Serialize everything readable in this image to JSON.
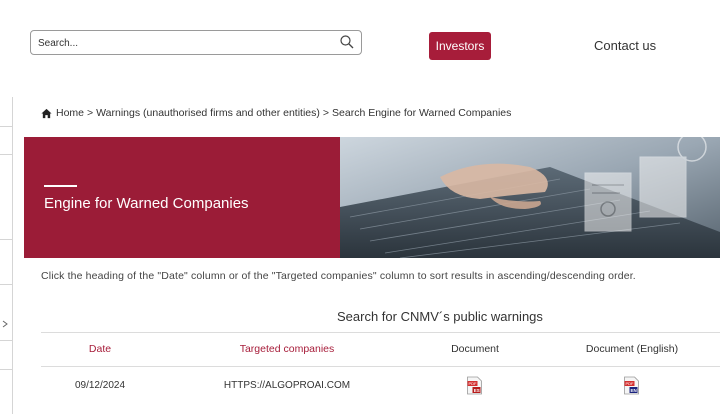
{
  "header": {
    "search_placeholder": "Search...",
    "investors_label": "Investors",
    "contact_label": "Contact us"
  },
  "breadcrumb": {
    "items": [
      "Home",
      "Warnings (unauthorised firms and other entities)",
      "Search Engine for Warned Companies"
    ],
    "separator": ">"
  },
  "banner": {
    "title": "Engine for Warned Companies"
  },
  "instructions": "Click the heading of the \"Date\" column or of the \"Targeted companies\" column to sort results in ascending/descending order.",
  "table": {
    "title": "Search for CNMV´s public warnings",
    "headers": [
      "Date",
      "Targeted companies",
      "Document",
      "Document (English)"
    ],
    "rows": [
      {
        "date": "09/12/2024",
        "company": "HTTPS://ALGOPROAI.COM",
        "document_icon": "pdf-es-icon",
        "document_en_icon": "pdf-en-icon"
      }
    ]
  },
  "colors": {
    "brand": "#a71d3a",
    "banner": "#9b1c37"
  }
}
